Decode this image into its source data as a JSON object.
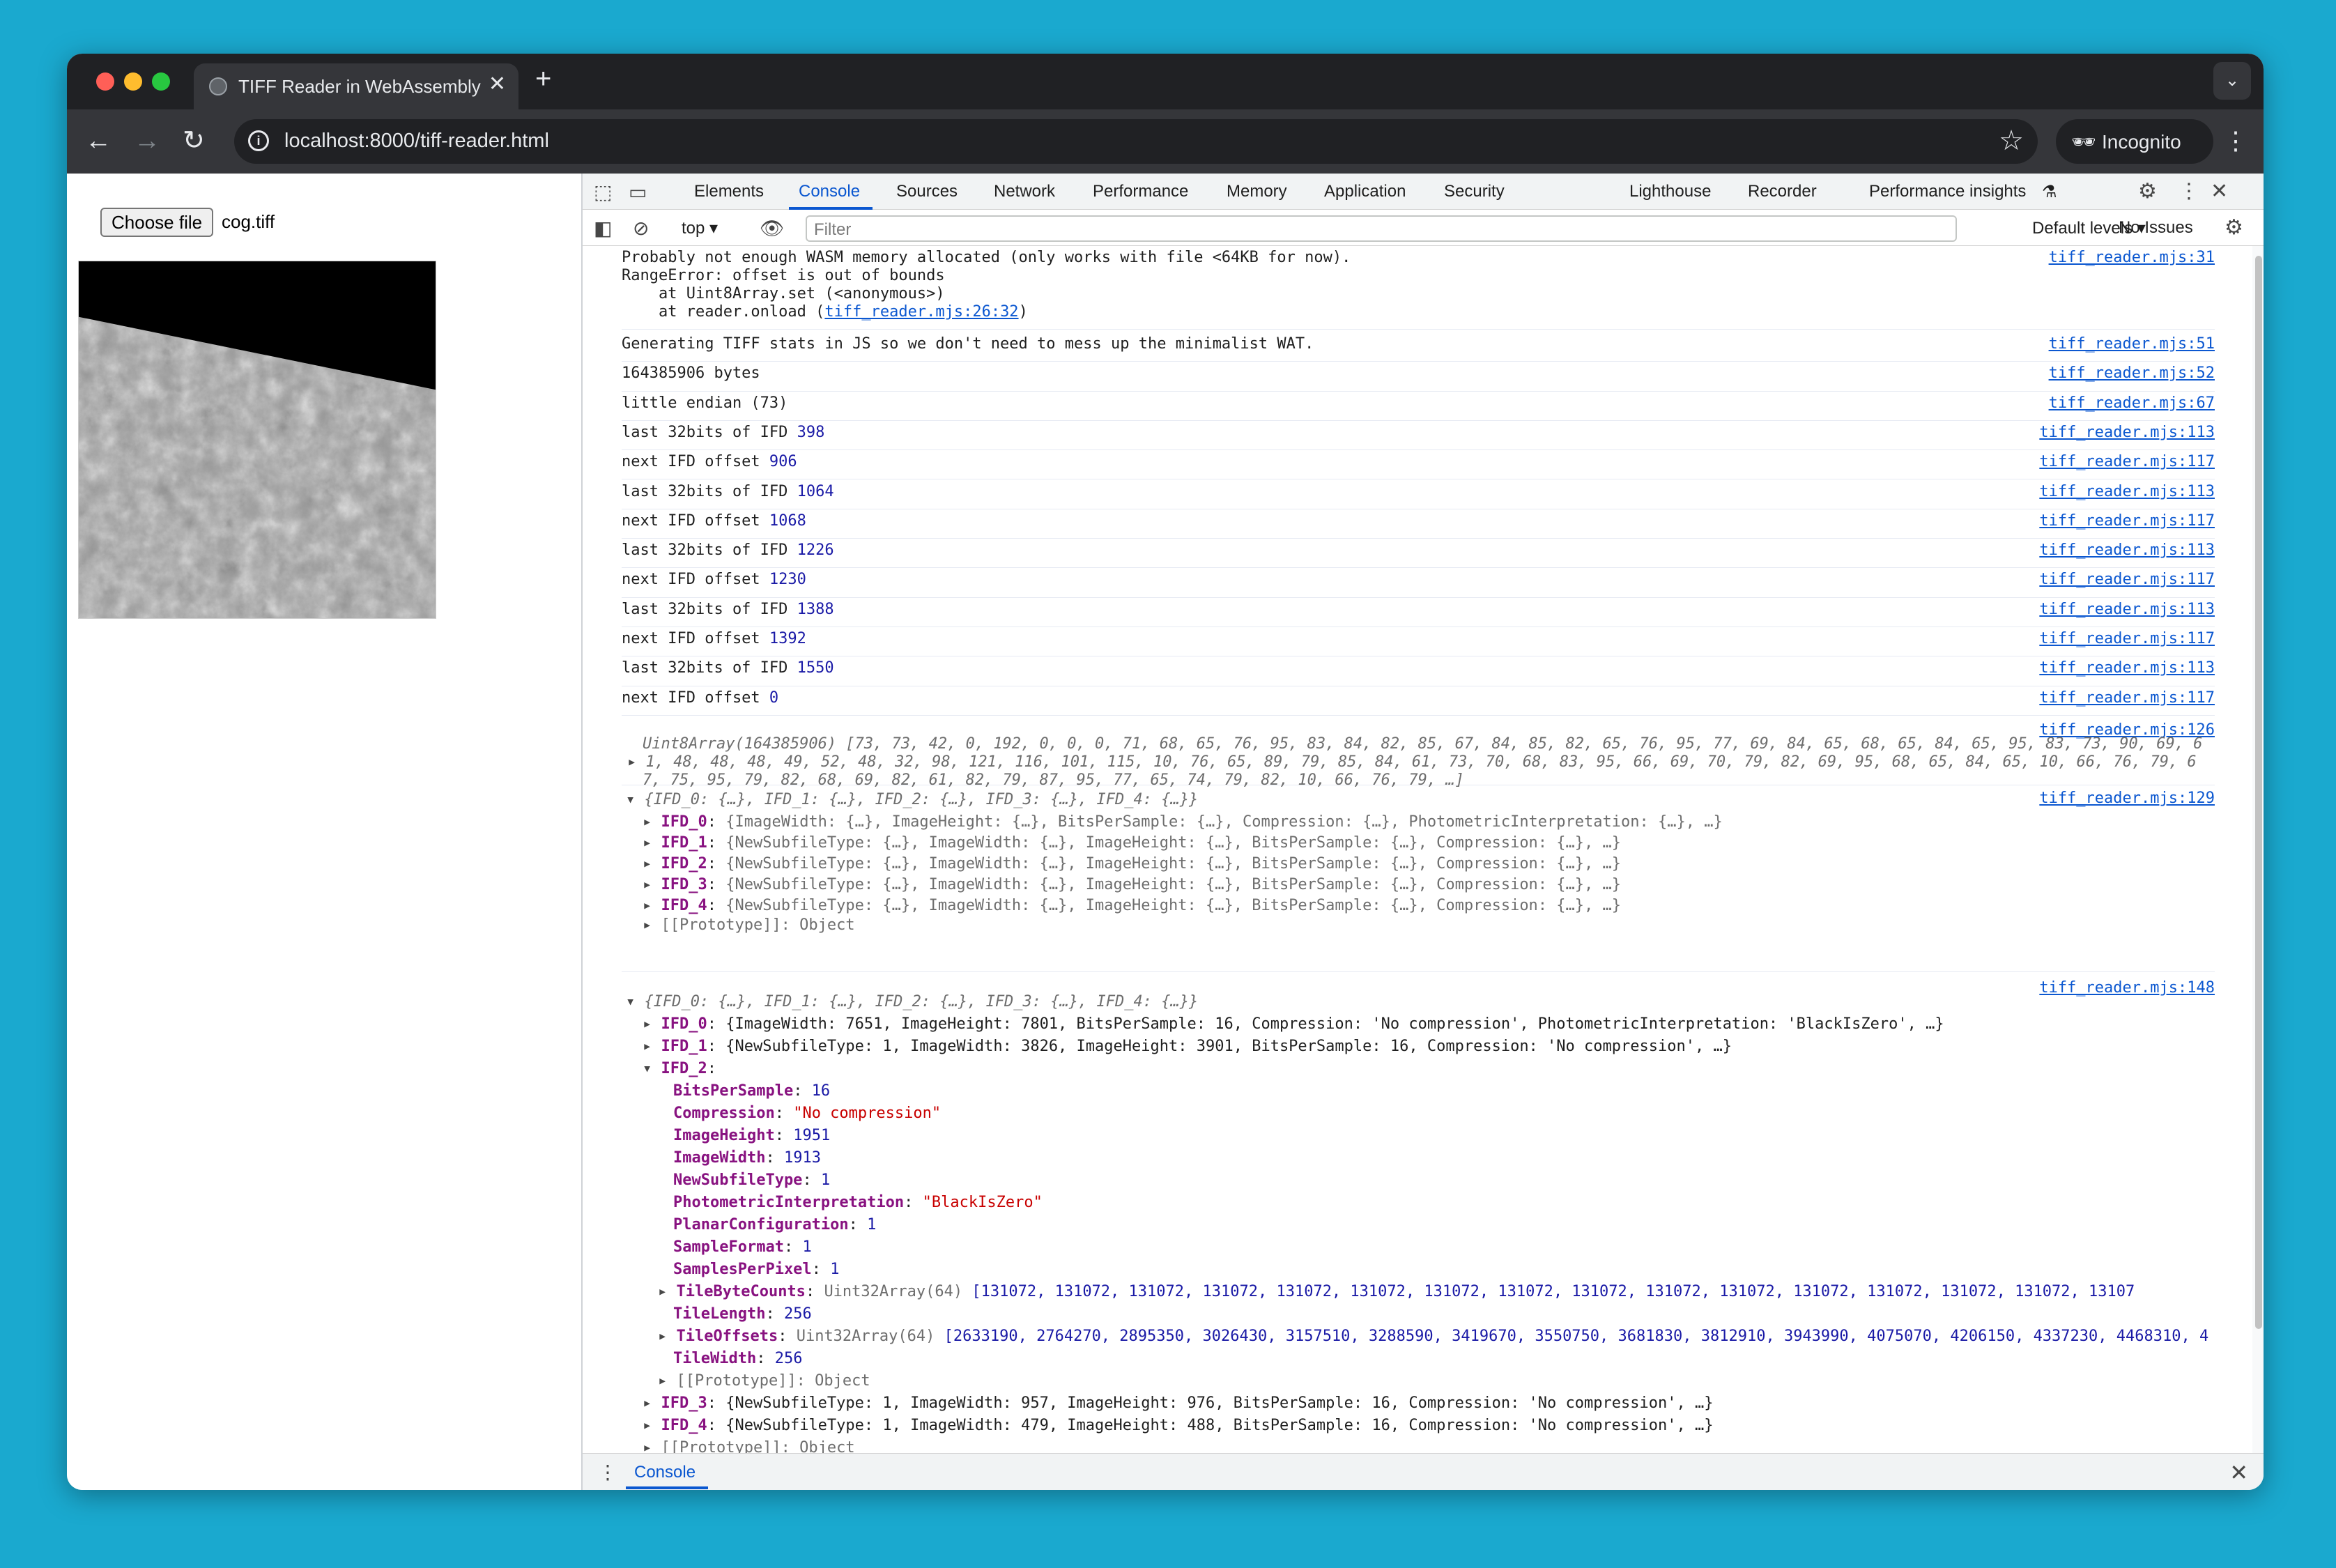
{
  "browser": {
    "tab_title": "TIFF Reader in WebAssembly",
    "tab_close": "✕",
    "new_tab": "+",
    "url": "localhost:8000/tiff-reader.html",
    "incognito_label": "Incognito"
  },
  "page": {
    "file_button": "Choose file",
    "file_name": "cog.tiff"
  },
  "devtools": {
    "tabs": [
      "Elements",
      "Console",
      "Sources",
      "Network",
      "Performance",
      "Memory",
      "Application",
      "Security",
      "Lighthouse",
      "Recorder",
      "Performance insights"
    ],
    "active_tab": "Console",
    "context": "top ▾",
    "filter_placeholder": "Filter",
    "levels": "Default levels ▾",
    "issues": "No Issues",
    "drawer_tab": "Console"
  },
  "console": {
    "error": {
      "lines": [
        "Probably not enough WASM memory allocated (only works with file <64KB for now).",
        "RangeError: offset is out of bounds",
        "    at Uint8Array.set (<anonymous>)",
        "    at reader.onload ("
      ],
      "inner_link": "tiff_reader.mjs:26:32",
      "src": "tiff_reader.mjs:31"
    },
    "logs": [
      {
        "label": "Generating TIFF stats in JS so we don't need to mess up the minimalist WAT.",
        "value": "",
        "src": "tiff_reader.mjs:51"
      },
      {
        "label": "164385906 bytes",
        "value": "",
        "src": "tiff_reader.mjs:52"
      },
      {
        "label": "little endian (73)",
        "value": "",
        "src": "tiff_reader.mjs:67"
      },
      {
        "label": "last 32bits of IFD ",
        "value": "398",
        "src": "tiff_reader.mjs:113"
      },
      {
        "label": "next IFD offset ",
        "value": "906",
        "src": "tiff_reader.mjs:117"
      },
      {
        "label": "last 32bits of IFD ",
        "value": "1064",
        "src": "tiff_reader.mjs:113"
      },
      {
        "label": "next IFD offset ",
        "value": "1068",
        "src": "tiff_reader.mjs:117"
      },
      {
        "label": "last 32bits of IFD ",
        "value": "1226",
        "src": "tiff_reader.mjs:113"
      },
      {
        "label": "next IFD offset ",
        "value": "1230",
        "src": "tiff_reader.mjs:117"
      },
      {
        "label": "last 32bits of IFD ",
        "value": "1388",
        "src": "tiff_reader.mjs:113"
      },
      {
        "label": "next IFD offset ",
        "value": "1392",
        "src": "tiff_reader.mjs:117"
      },
      {
        "label": "last 32bits of IFD ",
        "value": "1550",
        "src": "tiff_reader.mjs:113"
      },
      {
        "label": "next IFD offset ",
        "value": "0",
        "src": "tiff_reader.mjs:117"
      }
    ],
    "uint8": {
      "src": "tiff_reader.mjs:126",
      "line1": "Uint8Array(164385906) [73, 73, 42, 0, 192, 0, 0, 0, 71, 68, 65, 76, 95, 83, 84, 82, 85, 67, 84, 85, 82, 65, 76, 95, 77, 69, 84, 65, 68, 65, 84, 65, 95, 83, 73, 90, 69, 6",
      "line2": "1, 48, 48, 48, 49, 52, 48, 32, 98, 121, 116, 101, 115, 10, 76, 65, 89, 79, 85, 84, 61, 73, 70, 68, 83, 95, 66, 69, 70, 79, 82, 69, 95, 68, 65, 84, 65, 10, 66, 76, 79, 6",
      "line3": "7, 75, 95, 79, 82, 68, 69, 82, 61, 82, 79, 87, 95, 77, 65, 74, 79, 82, 10, 66, 76, 79, …]"
    },
    "obj1": {
      "src": "tiff_reader.mjs:129",
      "summary": "{IFD_0: {…}, IFD_1: {…}, IFD_2: {…}, IFD_3: {…}, IFD_4: {…}}",
      "rows": [
        {
          "key": "IFD_0",
          "val": "{ImageWidth: {…}, ImageHeight: {…}, BitsPerSample: {…}, Compression: {…}, PhotometricInterpretation: {…}, …}"
        },
        {
          "key": "IFD_1",
          "val": "{NewSubfileType: {…}, ImageWidth: {…}, ImageHeight: {…}, BitsPerSample: {…}, Compression: {…}, …}"
        },
        {
          "key": "IFD_2",
          "val": "{NewSubfileType: {…}, ImageWidth: {…}, ImageHeight: {…}, BitsPerSample: {…}, Compression: {…}, …}"
        },
        {
          "key": "IFD_3",
          "val": "{NewSubfileType: {…}, ImageWidth: {…}, ImageHeight: {…}, BitsPerSample: {…}, Compression: {…}, …}"
        },
        {
          "key": "IFD_4",
          "val": "{NewSubfileType: {…}, ImageWidth: {…}, ImageHeight: {…}, BitsPerSample: {…}, Compression: {…}, …}"
        }
      ],
      "proto": "[[Prototype]]: Object"
    },
    "obj2": {
      "src": "tiff_reader.mjs:148",
      "summary": "{IFD_0: {…}, IFD_1: {…}, IFD_2: {…}, IFD_3: {…}, IFD_4: {…}}",
      "ifd0": "{ImageWidth: 7651, ImageHeight: 7801, BitsPerSample: 16, Compression: 'No compression', PhotometricInterpretation: 'BlackIsZero', …}",
      "ifd1": "{NewSubfileType: 1, ImageWidth: 3826, ImageHeight: 3901, BitsPerSample: 16, Compression: 'No compression', …}",
      "ifd2_props": [
        {
          "k": "BitsPerSample",
          "v": "16",
          "t": "num"
        },
        {
          "k": "Compression",
          "v": "\"No compression\"",
          "t": "str"
        },
        {
          "k": "ImageHeight",
          "v": "1951",
          "t": "num"
        },
        {
          "k": "ImageWidth",
          "v": "1913",
          "t": "num"
        },
        {
          "k": "NewSubfileType",
          "v": "1",
          "t": "num"
        },
        {
          "k": "PhotometricInterpretation",
          "v": "\"BlackIsZero\"",
          "t": "str"
        },
        {
          "k": "PlanarConfiguration",
          "v": "1",
          "t": "num"
        },
        {
          "k": "SampleFormat",
          "v": "1",
          "t": "num"
        },
        {
          "k": "SamplesPerPixel",
          "v": "1",
          "t": "num"
        }
      ],
      "tile_byte_counts_type": "Uint32Array(64)",
      "tile_byte_counts": "[131072, 131072, 131072, 131072, 131072, 131072, 131072, 131072, 131072, 131072, 131072, 131072, 131072, 131072, 131072, 13107",
      "tile_length": "256",
      "tile_offsets_type": "Uint32Array(64)",
      "tile_offsets": "[2633190, 2764270, 2895350, 3026430, 3157510, 3288590, 3419670, 3550750, 3681830, 3812910, 3943990, 4075070, 4206150, 4337230, 4468310, 4",
      "tile_width": "256",
      "ifd2_proto": "[[Prototype]]: Object",
      "ifd3": "{NewSubfileType: 1, ImageWidth: 957, ImageHeight: 976, BitsPerSample: 16, Compression: 'No compression', …}",
      "ifd4": "{NewSubfileType: 1, ImageWidth: 479, ImageHeight: 488, BitsPerSample: 16, Compression: 'No compression', …}",
      "proto_partial": "[[Prototype]]: Object"
    }
  }
}
